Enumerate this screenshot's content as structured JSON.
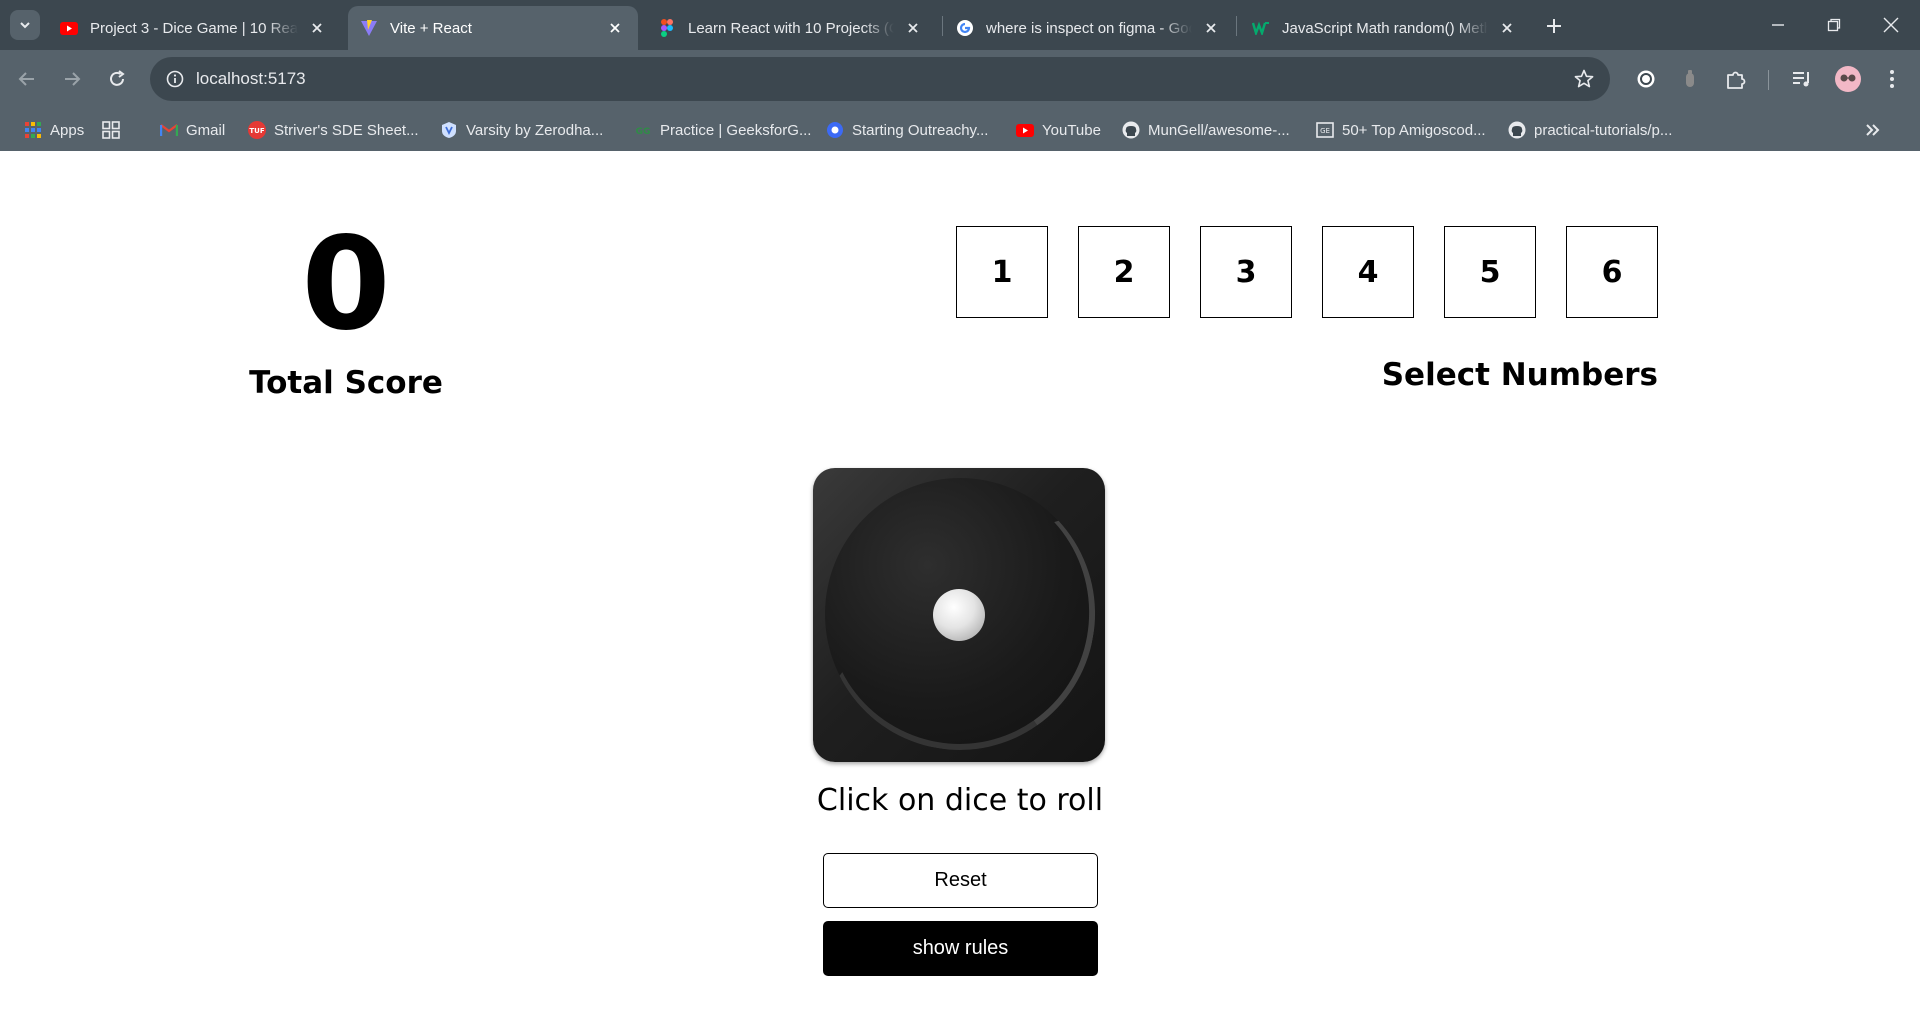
{
  "browser": {
    "tabs": [
      {
        "title": "Project 3 - Dice Game | 10 React",
        "icon": "youtube-icon",
        "active": false
      },
      {
        "title": "Vite + React",
        "icon": "vite-icon",
        "active": true
      },
      {
        "title": "Learn React with 10 Projects (Co",
        "icon": "figma-icon",
        "active": false
      },
      {
        "title": "where is inspect on figma - Goo",
        "icon": "google-icon",
        "active": false
      },
      {
        "title": "JavaScript Math random() Meth",
        "icon": "w3-icon",
        "active": false
      }
    ],
    "address_bar": {
      "url": "localhost:5173"
    },
    "bookmarks": [
      {
        "label": "Apps",
        "icon": "apps-grid-icon"
      },
      {
        "label": "",
        "icon": "tab-groups-icon"
      },
      {
        "label": "Gmail",
        "icon": "gmail-icon"
      },
      {
        "label": "Striver's SDE Sheet...",
        "icon": "tuf-icon"
      },
      {
        "label": "Varsity by Zerodha...",
        "icon": "varsity-icon"
      },
      {
        "label": "Practice | GeeksforG...",
        "icon": "gfg-icon"
      },
      {
        "label": "Starting Outreachy...",
        "icon": "outreachy-icon"
      },
      {
        "label": "YouTube",
        "icon": "youtube-icon"
      },
      {
        "label": "MunGell/awesome-...",
        "icon": "github-icon"
      },
      {
        "label": "50+ Top Amigoscod...",
        "icon": "amigoscode-icon"
      },
      {
        "label": "practical-tutorials/p...",
        "icon": "github-icon"
      }
    ]
  },
  "game": {
    "total_score": "0",
    "total_score_label": "Total Score",
    "numbers": [
      "1",
      "2",
      "3",
      "4",
      "5",
      "6"
    ],
    "select_label": "Select Numbers",
    "dice_value": 1,
    "roll_hint": "Click on dice to roll",
    "reset_label": "Reset",
    "rules_label": "show rules"
  }
}
